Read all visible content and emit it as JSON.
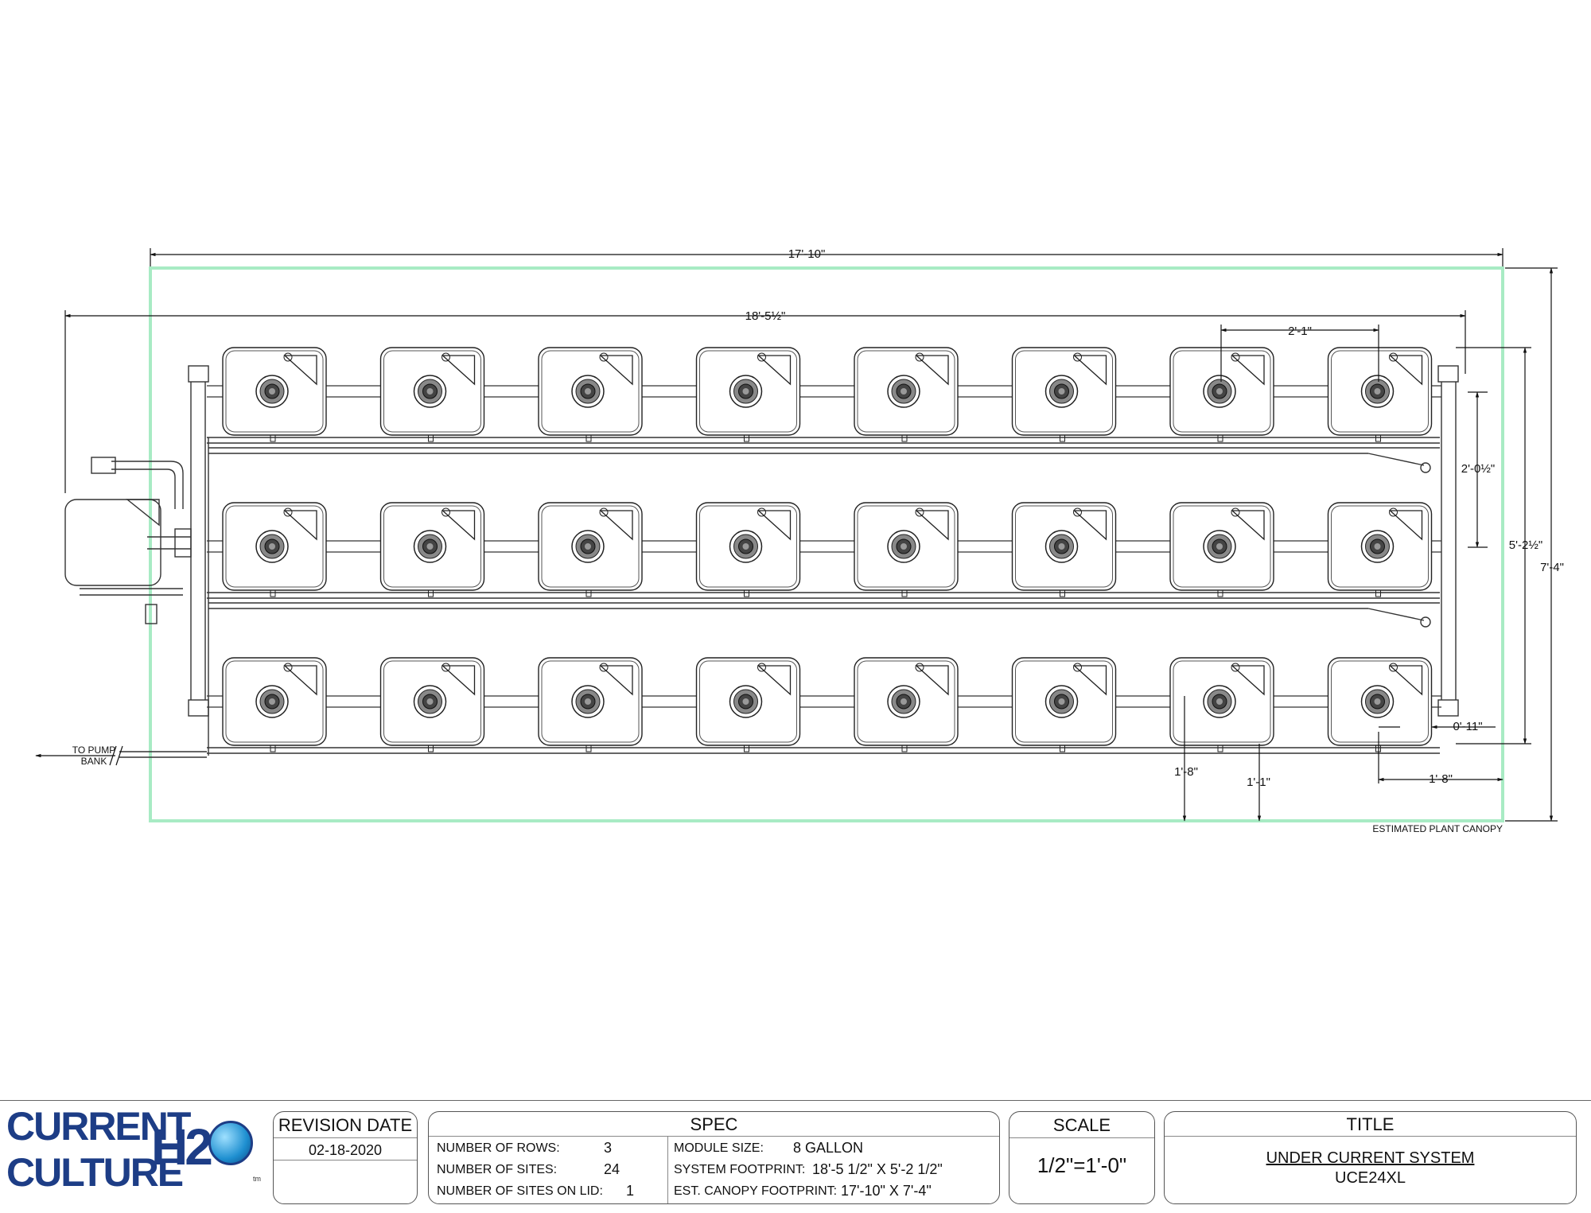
{
  "dimensions": {
    "canopy_width": "17'-10\"",
    "system_width": "18'-5½\"",
    "module_spacing": "2'-1\"",
    "row_spacing": "2'-0½\"",
    "system_depth": "5'-2½\"",
    "canopy_depth": "7'-4\"",
    "edge_offset": "0'-11\"",
    "bottom_left": "1'-8\"",
    "bottom_mid": "1'-1\"",
    "bottom_right": "1'-8\""
  },
  "annotations": {
    "pump_label": "TO PUMP\nBANK",
    "canopy_label": "ESTIMATED PLANT CANOPY"
  },
  "layout": {
    "rows": 3,
    "modules_per_row": 8
  },
  "colors": {
    "canopy_outline": "#a8ebc4",
    "logo_blue": "#1d3d86",
    "logo_sphere": "#1e8fd0"
  },
  "logo": {
    "line1": "CURRENT",
    "line2": "CULTURE",
    "mark": "H2O",
    "tm": "tm"
  },
  "title_block": {
    "revision": {
      "header": "REVISION DATE",
      "date": "02-18-2020"
    },
    "spec": {
      "header": "SPEC",
      "rows_label": "NUMBER OF ROWS:",
      "rows_value": "3",
      "sites_label": "NUMBER OF SITES:",
      "sites_value": "24",
      "lid_label": "NUMBER OF SITES ON LID:",
      "lid_value": "1",
      "module_label": "MODULE SIZE:",
      "module_value": "8 GALLON",
      "footprint_label": "SYSTEM FOOTPRINT:",
      "footprint_value": "18'-5 1/2\" X 5'-2 1/2\"",
      "canopy_label": "EST. CANOPY FOOTPRINT:",
      "canopy_value": "17'-10\" X 7'-4\""
    },
    "scale": {
      "header": "SCALE",
      "value": "1/2\"=1'-0\""
    },
    "title": {
      "header": "TITLE",
      "line1": "UNDER CURRENT SYSTEM",
      "line2": "UCE24XL"
    }
  }
}
